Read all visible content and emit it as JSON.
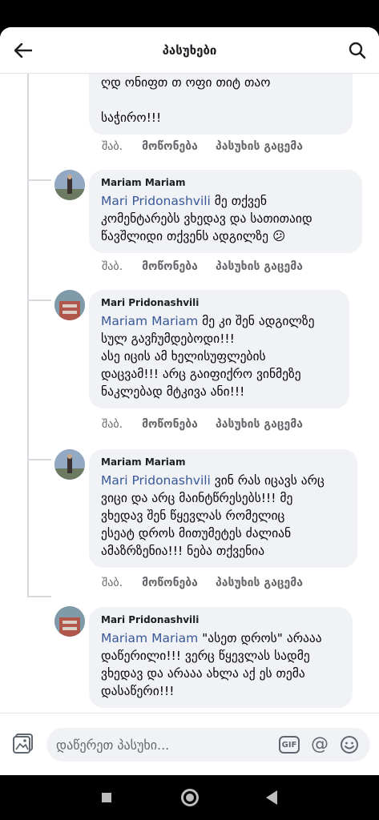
{
  "header": {
    "title": "პასუხები",
    "back_icon": "arrow-left-icon",
    "search_icon": "search-icon"
  },
  "top_partial": {
    "line1": "ღდ ონიფთ თ ოფი თიტ თაო",
    "line2": "საჭირო!!!"
  },
  "actions_labels": {
    "time": "შაბ.",
    "like": "მოწონება",
    "reply": "პასუხის გაცემა"
  },
  "comments": [
    {
      "author": "Mariam Mariam",
      "mention": "Mari Pridonashvili",
      "text": " მე თქვენ\nკომენტარებს ვხედავ და სათითაიდ\nწავშლიდი თქვენს ადგილზე 😕"
    },
    {
      "author": "Mari Pridonashvili",
      "mention": "Mariam Mariam",
      "text": " მე კი შენ ადგილზე\nსულ გავჩუმდებოდი!!!\n ასე იცის ამ ხელისუფლების\nდაცვამ!!! არც გაიფიქრო ვინმეზე\nნაკლებად მტკივა ანი!!!"
    },
    {
      "author": "Mariam Mariam",
      "mention": "Mari Pridonashvili",
      "text": " ვინ რას იცავს არც\nვიცი და არც მაინტწრესებს!!! მე\nვხედავ შენ წყევლას რომელიც\nესეატ დროს მითუმეტეს ძალიან\nამაზრზენია!!! ნება თქვენია"
    },
    {
      "author": "Mari Pridonashvili",
      "mention": "Mariam Mariam",
      "text": " \"ასეთ დროს\" არააა\nდაწერილი!!! ვერც წყევლას სადმე\nვხედავ და არააა ახლა აქ ეს თემა\nდასაწერი!!!"
    }
  ],
  "composer": {
    "placeholder": "დაწერეთ პასუხი...",
    "gif_label": "GIF",
    "at_label": "@"
  }
}
